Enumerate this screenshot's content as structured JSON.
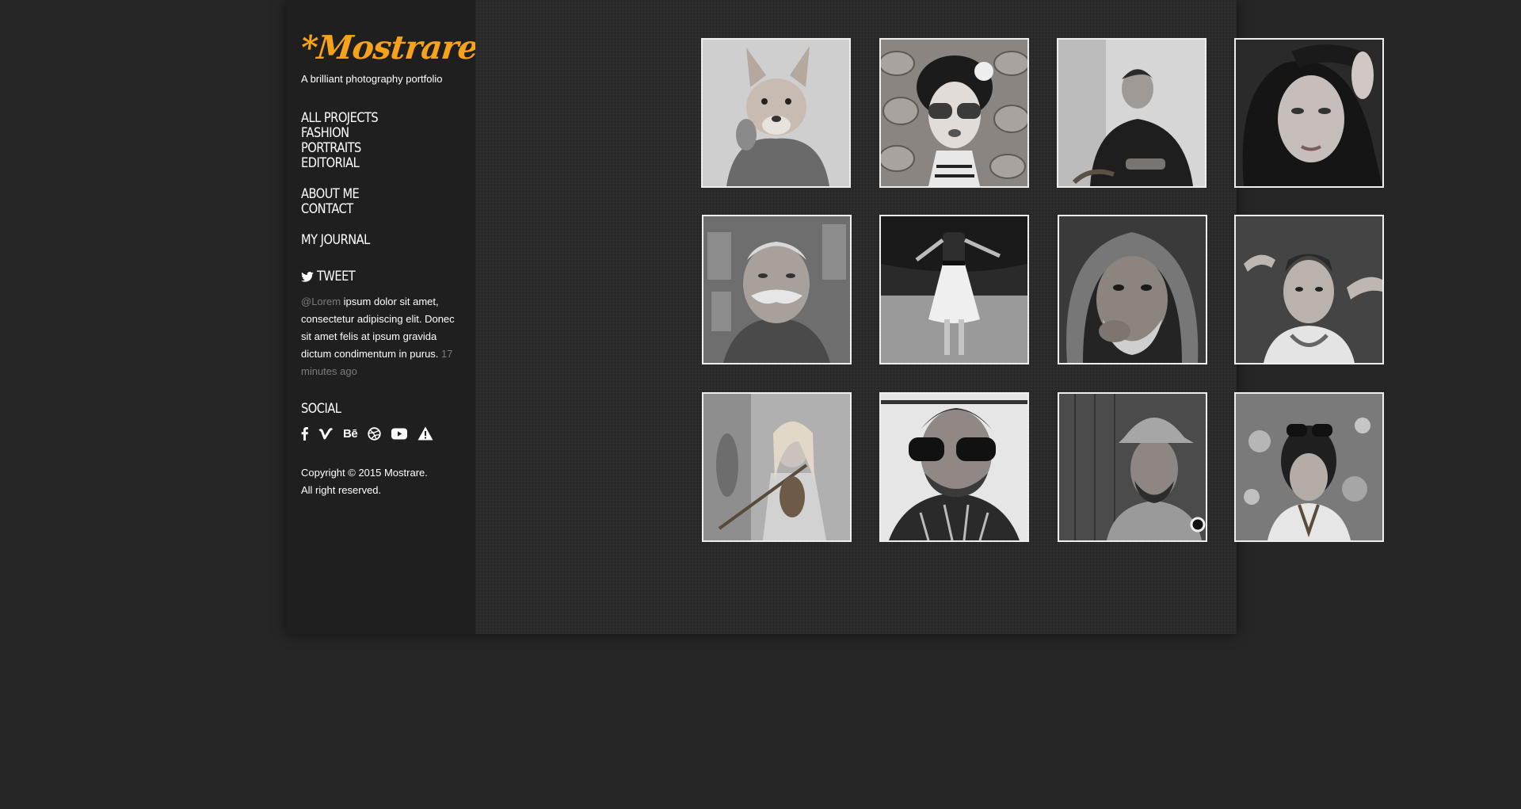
{
  "brand": {
    "logo_text": "*Mostrare",
    "tagline": "A brilliant photography portfolio",
    "accent_color": "#f7a21b"
  },
  "nav": {
    "group1": [
      "ALL PROJECTS",
      "FASHION",
      "PORTRAITS",
      "EDITORIAL"
    ],
    "group2": [
      "ABOUT ME",
      "CONTACT"
    ],
    "group3": [
      "MY JOURNAL"
    ]
  },
  "tweet": {
    "title": "TWEET",
    "icon": "twitter-icon",
    "handle": "@Lorem",
    "text": "ipsum dolor sit amet, consectetur adipiscing elit. Donec sit amet felis at ipsum gravida dictum condimentum in purus.",
    "time": "17 minutes ago"
  },
  "social": {
    "title": "SOCIAL",
    "icons": [
      "facebook-icon",
      "vimeo-icon",
      "behance-icon",
      "dribbble-icon",
      "youtube-icon",
      "warning-icon"
    ],
    "behance_text": "Bē"
  },
  "footer": {
    "copyright_line1": "Copyright © 2015 Mostrare.",
    "copyright_line2": "All right reserved."
  },
  "gallery": {
    "photos": [
      "photo-fox-mask",
      "photo-woman-sunglasses",
      "photo-man-armchair",
      "photo-woman-hat",
      "photo-old-man-mustache",
      "photo-girl-white-dress",
      "photo-hooded-old-man",
      "photo-young-man",
      "photo-violinist",
      "photo-man-goggles",
      "photo-man-fedora",
      "photo-girl-sunglasses-on-head"
    ]
  }
}
